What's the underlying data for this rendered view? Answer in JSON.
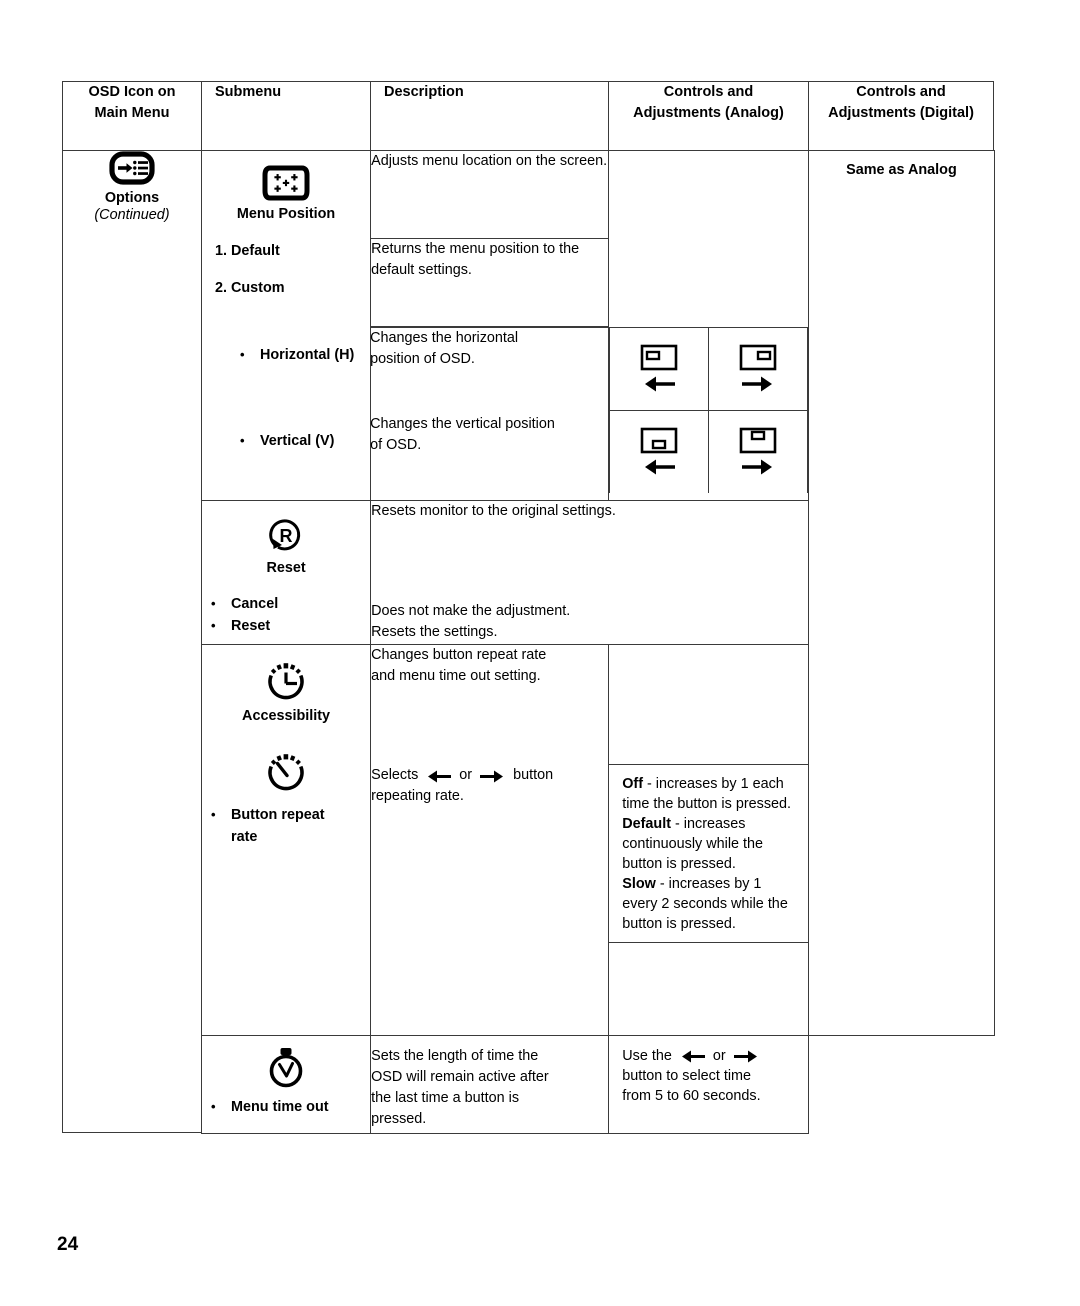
{
  "page": {
    "number": "24"
  },
  "table": {
    "headers": [
      "OSD Icon on\nMain Menu",
      "Submenu",
      "Description",
      "Controls and\nAdjustments (Analog)",
      "Controls and\nAdjustments (Digital)"
    ],
    "headers_lines": {
      "icon_l1": "OSD Icon on",
      "icon_l2": "Main Menu",
      "submenu": "Submenu",
      "description": "Description",
      "analog_l1": "Controls and",
      "analog_l2": "Adjustments (Analog)",
      "digital_l1": "Controls and",
      "digital_l2": "Adjustments (Digital)"
    }
  },
  "main_menu": {
    "icon": "options-icon",
    "label": "Options",
    "continued": "(Continued)"
  },
  "digital_column": {
    "same_as_analog": "Same as Analog"
  },
  "rows": {
    "menu_position": {
      "icon": "menu-position-icon",
      "title": "Menu Position",
      "item1": "1. Default",
      "item2": "2. Custom",
      "desc_main": "Adjusts menu location on the screen.",
      "desc_default": "Returns the menu position to the default settings."
    },
    "horizontal": {
      "bullet": "•",
      "label": "Horizontal (H)",
      "desc_l1": "Changes the horizontal",
      "desc_l2": "position of OSD.",
      "ctrl_left_icon": "monitor-osd-left-icon",
      "ctrl_left_arrow": "←",
      "ctrl_right_icon": "monitor-osd-right-icon",
      "ctrl_right_arrow": "→"
    },
    "vertical": {
      "bullet": "•",
      "label": "Vertical (V)",
      "desc_l1": "Changes the vertical position",
      "desc_l2": "of OSD.",
      "ctrl_left_icon": "monitor-osd-bottom-icon",
      "ctrl_left_arrow": "←",
      "ctrl_right_icon": "monitor-osd-top-icon",
      "ctrl_right_arrow": "→"
    },
    "reset": {
      "icon": "reset-icon",
      "title": "Reset",
      "desc_main": "Resets monitor to the original settings.",
      "bullet": "•",
      "cancel_label": "Cancel",
      "cancel_desc": "Does not make the adjustment.",
      "reset_label": "Reset",
      "reset_desc": "Resets the settings."
    },
    "accessibility": {
      "icon": "accessibility-clock-icon",
      "title": "Accessibility",
      "desc_l1": "Changes button repeat rate",
      "desc_l2": "and menu time out setting."
    },
    "button_repeat_rate": {
      "icon": "button-repeat-rate-icon",
      "bullet": "•",
      "label_l1": "Button repeat",
      "label_l2": "rate",
      "desc_pre": "Selects",
      "desc_arrow_left": "←",
      "desc_or": "or",
      "desc_arrow_right": "→",
      "desc_post": "button",
      "desc_l2": "repeating rate.",
      "note": {
        "off_label": "Off",
        "off_text": " - increases by 1 each time the button is pressed.",
        "default_label": "Default",
        "default_text": " - increases continuously while the button is pressed.",
        "slow_label": "Slow",
        "slow_text": " - increases by 1 every 2 seconds while the button is pressed."
      }
    },
    "menu_time_out": {
      "icon": "stopwatch-icon",
      "bullet": "•",
      "label": "Menu time out",
      "desc_l1": "Sets the length of time the",
      "desc_l2": "OSD will remain active after",
      "desc_l3": "the last time a button is",
      "desc_l4": "pressed.",
      "note_pre": "Use the",
      "note_arrow_left": "←",
      "note_or": "or",
      "note_arrow_right": "→",
      "note_l2": "button to select time",
      "note_l3": "from 5 to 60 seconds."
    }
  },
  "colors": {
    "border": "#3a3a3a",
    "text": "#000000",
    "background": "#ffffff"
  }
}
